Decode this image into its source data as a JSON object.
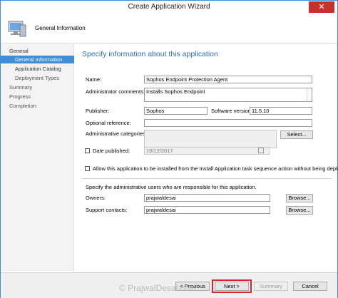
{
  "window": {
    "title": "Create Application Wizard",
    "close_glyph": "✕"
  },
  "header": {
    "title": "General Information",
    "icon": "computer-icon"
  },
  "sidebar": {
    "items": [
      {
        "label": "General"
      },
      {
        "label": "General Information"
      },
      {
        "label": "Application Catalog"
      },
      {
        "label": "Deployment Types"
      },
      {
        "label": "Summary"
      },
      {
        "label": "Progress"
      },
      {
        "label": "Completion"
      }
    ]
  },
  "content": {
    "heading": "Specify information about this application",
    "name": {
      "label": "Name:",
      "value": "Sophos Endpoint Protection Agent"
    },
    "admin_comments": {
      "label": "Administrator comments:",
      "value": "Installs Sophos Endpoint"
    },
    "publisher": {
      "label": "Publisher:",
      "value": "Sophos"
    },
    "software_version": {
      "label": "Software version:",
      "value": "11.5.10"
    },
    "optional_reference": {
      "label": "Optional reference:",
      "value": ""
    },
    "admin_categories": {
      "label": "Administrative categories:",
      "value": "",
      "button": "Select..."
    },
    "date_published": {
      "label": "Date published:",
      "value": "19/12/2017",
      "checked": false
    },
    "allow_install": {
      "label": "Allow this application to be installed from the Install Application task sequence action without being deployed",
      "checked": false
    },
    "specify_users": "Specify the administrative users who are responsible for this application.",
    "owners": {
      "label": "Owners:",
      "value": "prajwaldesai",
      "button": "Browse..."
    },
    "support_contacts": {
      "label": "Support contacts:",
      "value": "prajwaldesai",
      "button": "Browse..."
    }
  },
  "footer": {
    "previous": "< Previous",
    "next": "Next >",
    "summary": "Summary",
    "cancel": "Cancel"
  },
  "watermark": "© PrajwalDesai.com",
  "colors": {
    "accent": "#3f8fd6",
    "heading": "#2b6db5",
    "highlight": "#d9252b",
    "close": "#c7302b"
  }
}
